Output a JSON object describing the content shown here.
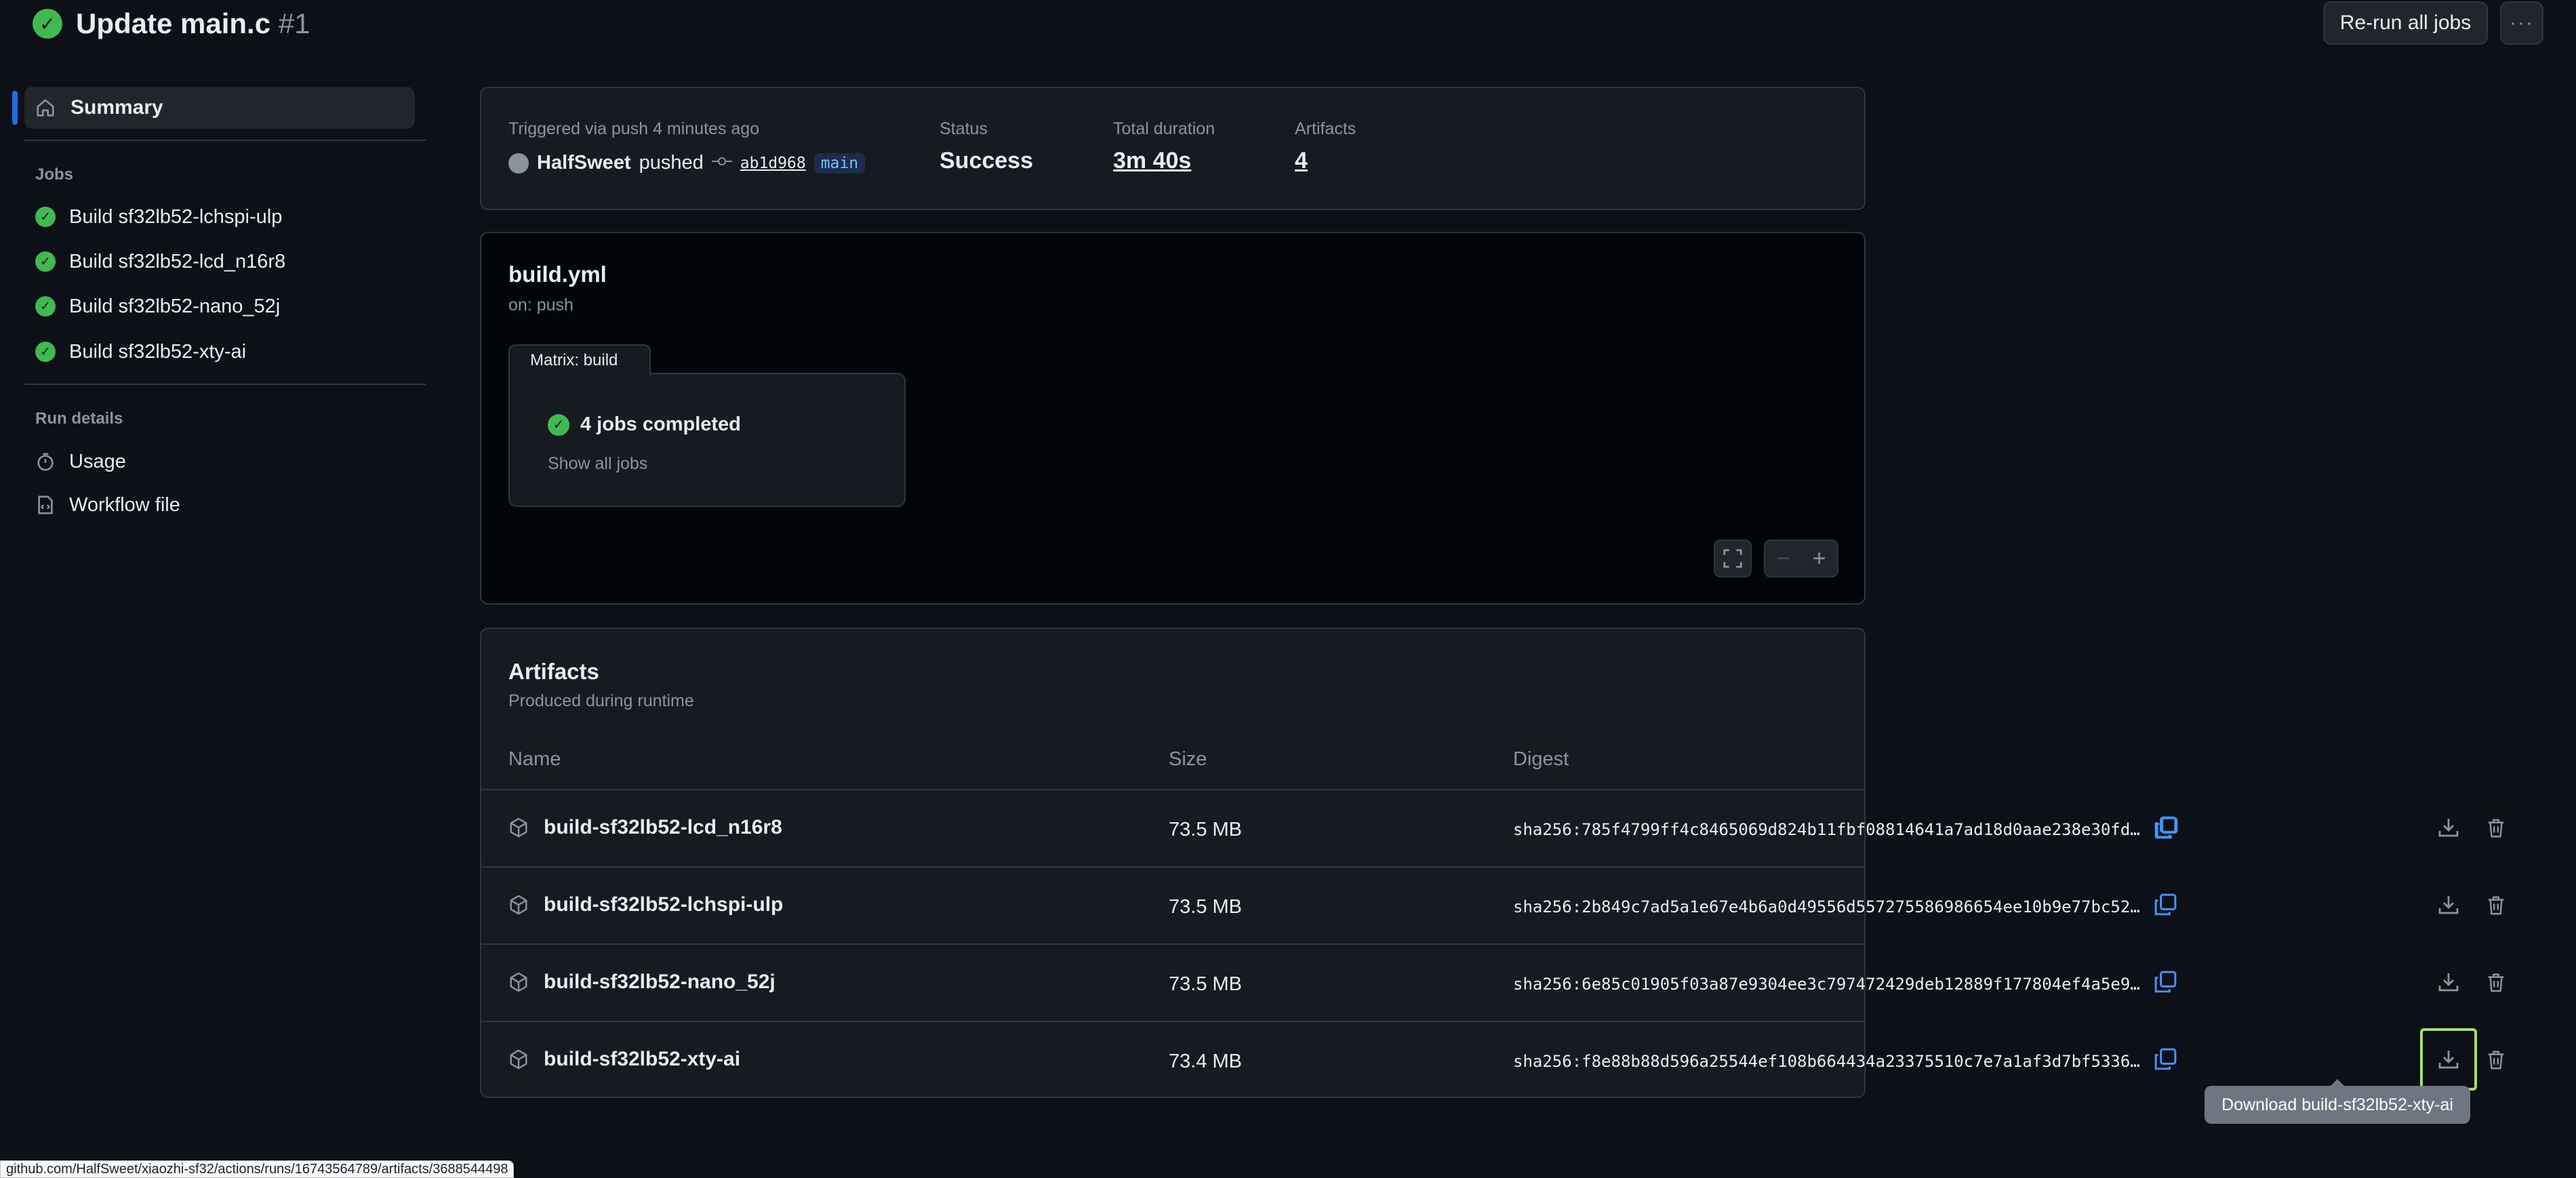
{
  "header": {
    "title": "Update main.c",
    "run_number": "#1",
    "rerun_label": "Re-run all jobs",
    "more_label": "···"
  },
  "sidebar": {
    "summary_label": "Summary",
    "jobs_heading": "Jobs",
    "jobs": [
      "Build sf32lb52-lchspi-ulp",
      "Build sf32lb52-lcd_n16r8",
      "Build sf32lb52-nano_52j",
      "Build sf32lb52-xty-ai"
    ],
    "run_details_heading": "Run details",
    "usage_label": "Usage",
    "workflow_file_label": "Workflow file"
  },
  "summary": {
    "trigger_text": "Triggered via push 4 minutes ago",
    "actor": "HalfSweet",
    "action": "pushed",
    "commit_sha": "ab1d968",
    "branch": "main",
    "status_label": "Status",
    "status_value": "Success",
    "duration_label": "Total duration",
    "duration_value": "3m 40s",
    "artifacts_label": "Artifacts",
    "artifacts_value": "4"
  },
  "graph": {
    "workflow_name": "build.yml",
    "trigger": "on: push",
    "matrix_label": "Matrix: build",
    "jobs_completed": "4 jobs completed",
    "show_all": "Show all jobs"
  },
  "artifacts": {
    "title": "Artifacts",
    "subtitle": "Produced during runtime",
    "columns": {
      "name": "Name",
      "size": "Size",
      "digest": "Digest"
    },
    "rows": [
      {
        "name": "build-sf32lb52-lcd_n16r8",
        "size": "73.5 MB",
        "digest": "sha256:785f4799ff4c8465069d824b11fbf08814641a7ad18d0aae238e30fd…"
      },
      {
        "name": "build-sf32lb52-lchspi-ulp",
        "size": "73.5 MB",
        "digest": "sha256:2b849c7ad5a1e67e4b6a0d49556d557275586986654ee10b9e77bc52…"
      },
      {
        "name": "build-sf32lb52-nano_52j",
        "size": "73.5 MB",
        "digest": "sha256:6e85c01905f03a87e9304ee3c797472429deb12889f177804ef4a5e9…"
      },
      {
        "name": "build-sf32lb52-xty-ai",
        "size": "73.4 MB",
        "digest": "sha256:f8e88b88d596a25544ef108b664434a23375510c7e7a1af3d7bf5336…"
      }
    ]
  },
  "tooltip": "Download build-sf32lb52-xty-ai",
  "statusbar_url": "github.com/HalfSweet/xiaozhi-sf32/actions/runs/16743564789/artifacts/3688544498",
  "colors": {
    "success": "#3fb950",
    "accent": "#1f6feb",
    "highlight": "#a6e35a",
    "copy_icon": "#4493f8"
  }
}
